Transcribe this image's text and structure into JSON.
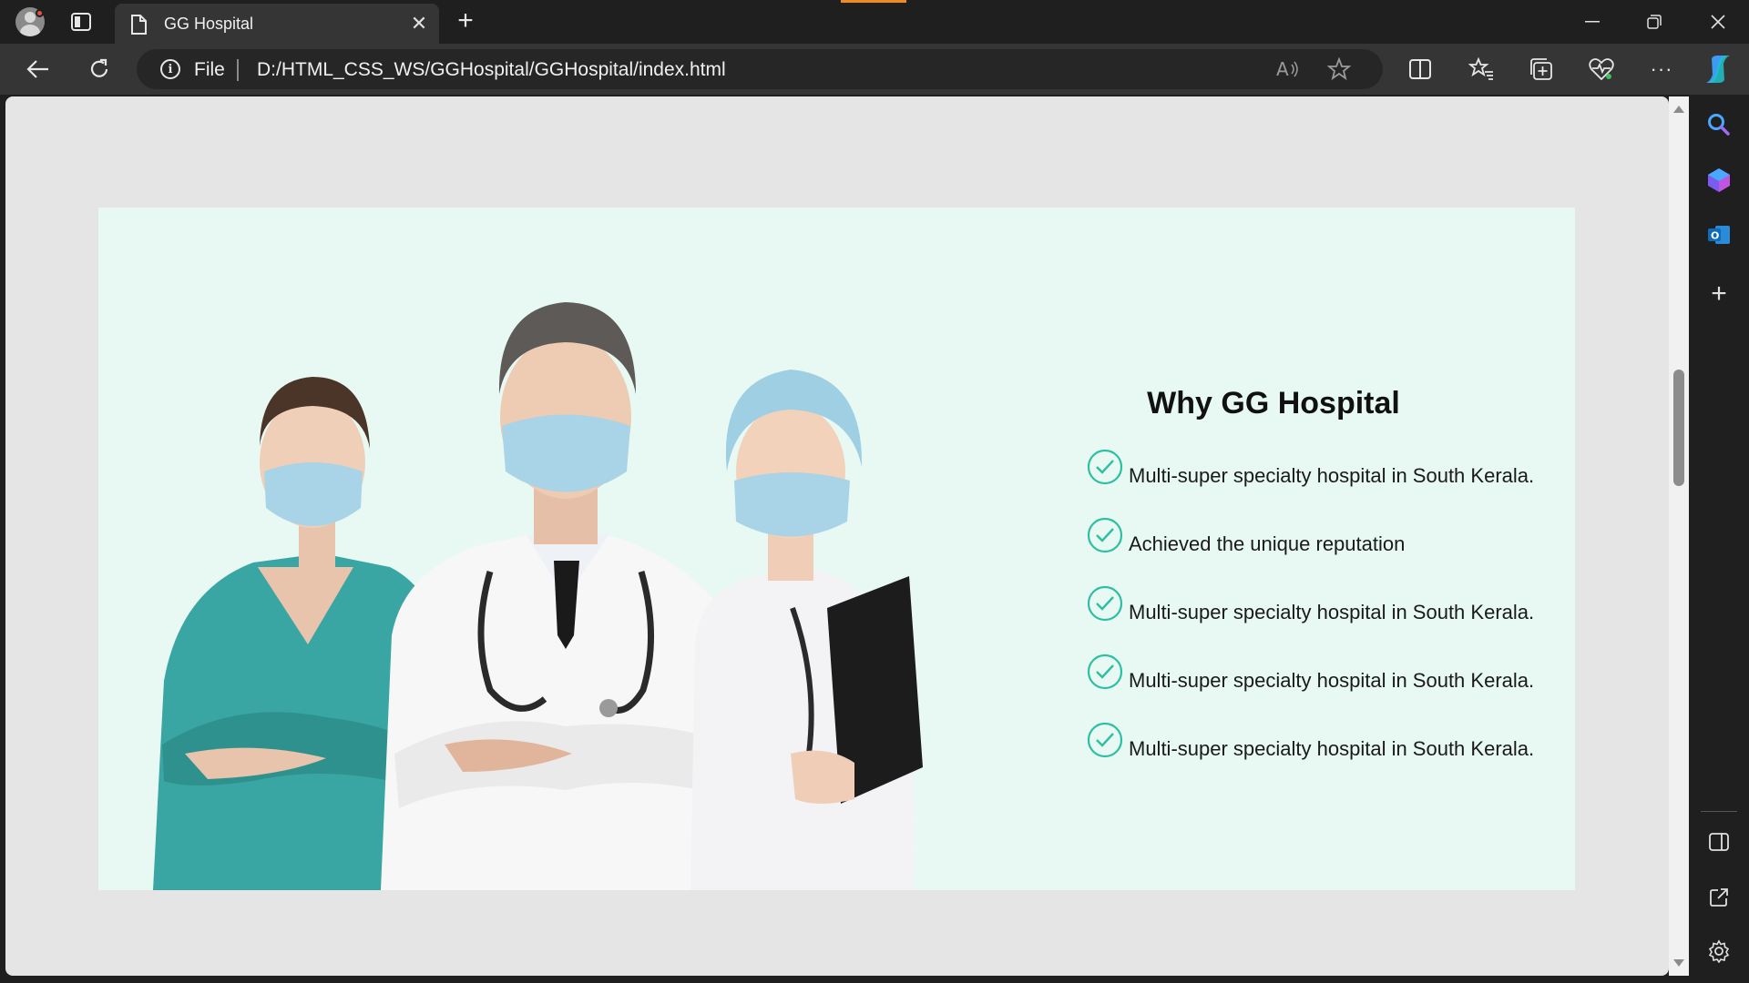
{
  "browser": {
    "tab_title": "GG Hospital",
    "address_scheme_label": "File",
    "url": "D:/HTML_CSS_WS/GGHospital/GGHospital/index.html"
  },
  "page": {
    "heading": "Why GG Hospital",
    "features": [
      "Multi-super specialty hospital in South Kerala.",
      "Achieved the unique reputation",
      "Multi-super specialty hospital in South Kerala.",
      "Multi-super specialty hospital in South Kerala.",
      "Multi-super specialty hospital in South Kerala."
    ],
    "hero_image": "doctors-team-image"
  },
  "colors": {
    "browser_chrome": "#1f1f1f",
    "toolbar": "#353535",
    "page_background": "#e5e5e5",
    "hero_background": "#e8f9f4",
    "check_accent": "#2dbfa2",
    "scrub_teal": "#3aa6a3"
  },
  "icons": {
    "sidebar": [
      "search-icon",
      "copilot-icon",
      "outlook-icon",
      "add-icon",
      "sidebar-panel-icon",
      "external-link-icon",
      "settings-icon"
    ]
  }
}
